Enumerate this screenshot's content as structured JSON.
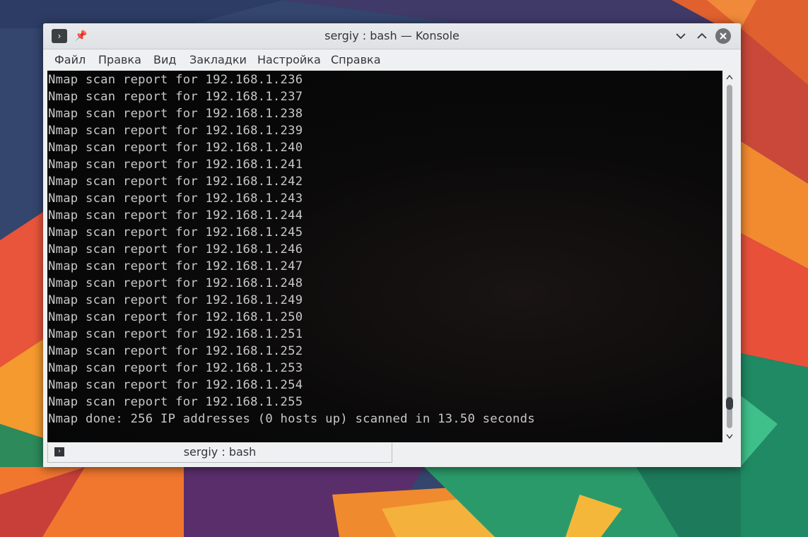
{
  "window": {
    "title": "sergiy : bash — Konsole",
    "app_icon": "terminal-icon",
    "pin_icon": "pin-icon"
  },
  "menu": {
    "items": [
      "Файл",
      "Правка",
      "Вид",
      "Закладки",
      "Настройка",
      "Справка"
    ]
  },
  "terminal": {
    "lines": [
      "Nmap scan report for 192.168.1.236",
      "Nmap scan report for 192.168.1.237",
      "Nmap scan report for 192.168.1.238",
      "Nmap scan report for 192.168.1.239",
      "Nmap scan report for 192.168.1.240",
      "Nmap scan report for 192.168.1.241",
      "Nmap scan report for 192.168.1.242",
      "Nmap scan report for 192.168.1.243",
      "Nmap scan report for 192.168.1.244",
      "Nmap scan report for 192.168.1.245",
      "Nmap scan report for 192.168.1.246",
      "Nmap scan report for 192.168.1.247",
      "Nmap scan report for 192.168.1.248",
      "Nmap scan report for 192.168.1.249",
      "Nmap scan report for 192.168.1.250",
      "Nmap scan report for 192.168.1.251",
      "Nmap scan report for 192.168.1.252",
      "Nmap scan report for 192.168.1.253",
      "Nmap scan report for 192.168.1.254",
      "Nmap scan report for 192.168.1.255",
      "Nmap done: 256 IP addresses (0 hosts up) scanned in 13.50 seconds"
    ],
    "text_color": "#c8c8c8",
    "background_color": "#050505"
  },
  "tabs": [
    {
      "label": "sergiy : bash",
      "icon": "terminal-icon"
    }
  ],
  "colors": {
    "accent": "#3daee9",
    "close_button": "#6e7275"
  }
}
